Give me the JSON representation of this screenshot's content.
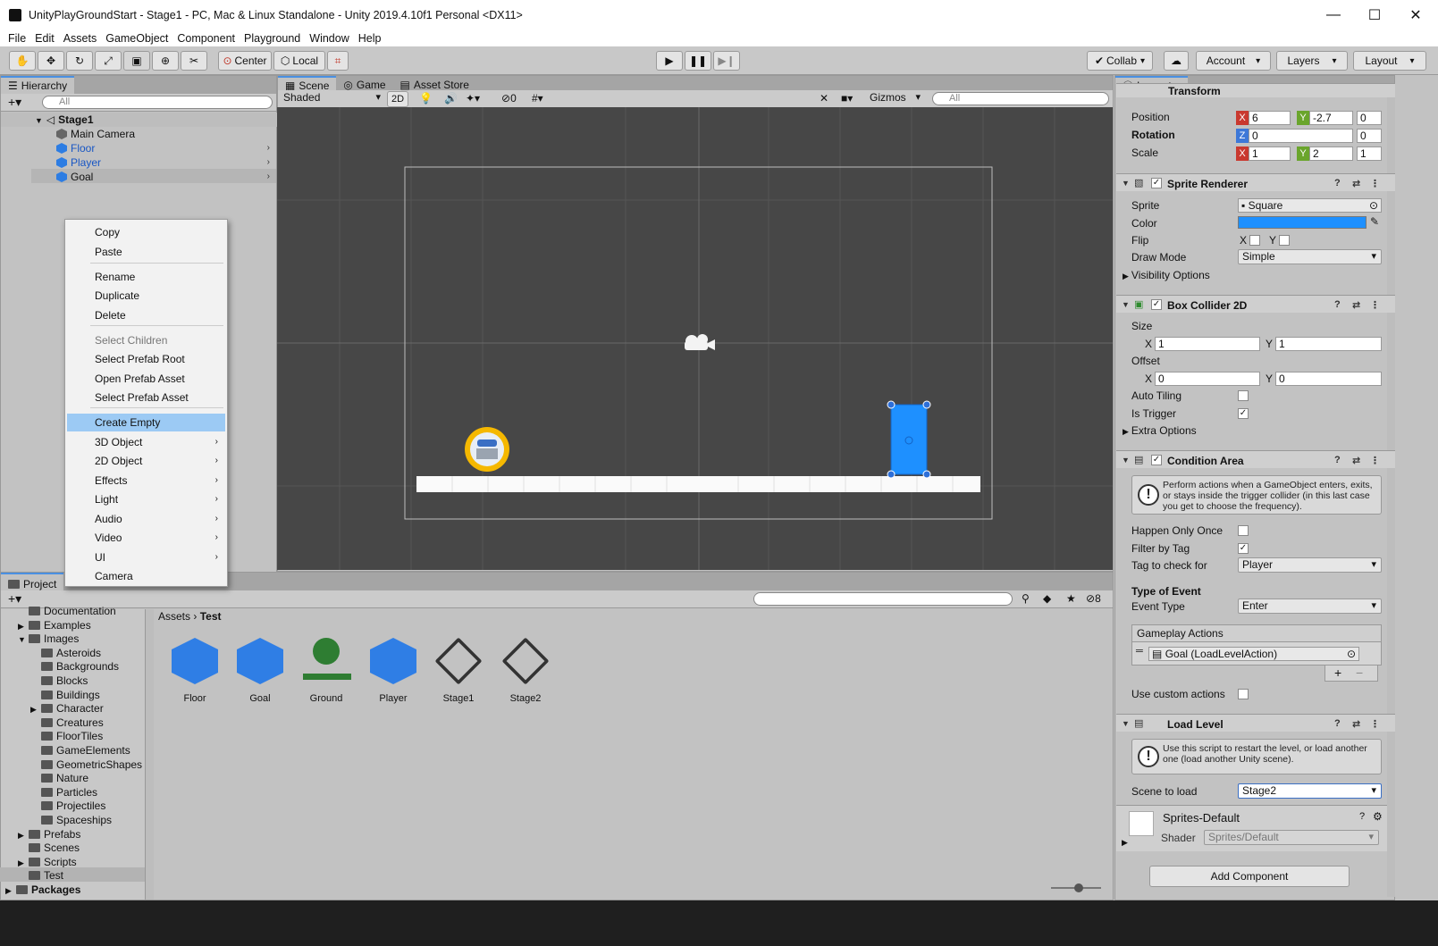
{
  "window": {
    "title": "UnityPlayGroundStart - Stage1 - PC, Mac & Linux Standalone - Unity 2019.4.10f1 Personal <DX11>",
    "minimize": "—",
    "maximize": "☐",
    "close": "✕"
  },
  "menu": [
    "File",
    "Edit",
    "Assets",
    "GameObject",
    "Component",
    "Playground",
    "Window",
    "Help"
  ],
  "toolbar": {
    "center": "Center",
    "local": "Local",
    "collab": "Collab",
    "account": "Account",
    "layers": "Layers",
    "layout": "Layout"
  },
  "hierarchy": {
    "tab": "Hierarchy",
    "search_placeholder": "All",
    "scene": "Stage1",
    "items": [
      {
        "label": "Main Camera",
        "prefab": false
      },
      {
        "label": "Floor",
        "prefab": true
      },
      {
        "label": "Player",
        "prefab": true
      },
      {
        "label": "Goal",
        "prefab": true
      }
    ]
  },
  "context_menu": {
    "items": [
      "Copy",
      "Paste",
      "Rename",
      "Duplicate",
      "Delete",
      "Select Children",
      "Select Prefab Root",
      "Open Prefab Asset",
      "Select Prefab Asset",
      "Create Empty",
      "3D Object",
      "2D Object",
      "Effects",
      "Light",
      "Audio",
      "Video",
      "UI",
      "Camera"
    ],
    "highlighted": "Create Empty",
    "disabled": [
      "Select Children"
    ]
  },
  "scene_tabs": {
    "scene": "Scene",
    "game": "Game",
    "asset_store": "Asset Store"
  },
  "scene_toolbar": {
    "shading": "Shaded",
    "mode_2d": "2D",
    "hidden_count": "0",
    "gizmos": "Gizmos",
    "search_placeholder": "All"
  },
  "inspector": {
    "tab": "Inspector",
    "transform": {
      "title": "Transform",
      "position_label": "Position",
      "position": {
        "x": "6",
        "y": "-2.7",
        "z": "0"
      },
      "rotation_label": "Rotation",
      "rotation": {
        "z": "0",
        "extra": "0"
      },
      "scale_label": "Scale",
      "scale": {
        "x": "1",
        "y": "2",
        "z": "1"
      }
    },
    "sprite_renderer": {
      "title": "Sprite Renderer",
      "sprite_label": "Sprite",
      "sprite": "Square",
      "color_label": "Color",
      "color": "#1e90ff",
      "flip_label": "Flip",
      "flip_x": "X",
      "flip_y": "Y",
      "draw_mode_label": "Draw Mode",
      "draw_mode": "Simple",
      "visibility": "Visibility Options"
    },
    "box_collider": {
      "title": "Box Collider 2D",
      "size_label": "Size",
      "size": {
        "x": "1",
        "y": "1"
      },
      "offset_label": "Offset",
      "offset": {
        "x": "0",
        "y": "0"
      },
      "auto_tiling_label": "Auto Tiling",
      "is_trigger_label": "Is Trigger",
      "extra": "Extra Options"
    },
    "condition_area": {
      "title": "Condition Area",
      "help": "Perform actions when a GameObject enters, exits, or stays inside the trigger collider (in this last case you get to choose the frequency).",
      "happen_once_label": "Happen Only Once",
      "filter_tag_label": "Filter by Tag",
      "tag_check_label": "Tag to check for",
      "tag_check": "Player",
      "type_of_event": "Type of Event",
      "event_type_label": "Event Type",
      "event_type": "Enter",
      "gameplay_actions": "Gameplay Actions",
      "action": "Goal (LoadLevelAction)",
      "plus": "+",
      "minus": "−",
      "custom_actions_label": "Use custom actions"
    },
    "load_level": {
      "title": "Load Level",
      "help": "Use this script to restart the level, or load another one (load another Unity scene).",
      "scene_label": "Scene to load",
      "scene": "Stage2"
    },
    "material": {
      "name": "Sprites-Default",
      "shader_label": "Shader",
      "shader": "Sprites/Default"
    },
    "add_component": "Add Component"
  },
  "project": {
    "tab": "Project",
    "breadcrumb": [
      "Assets",
      "Test"
    ],
    "hidden_count": "8",
    "tree": [
      {
        "label": "Documentation",
        "indent": 1,
        "arrow": ""
      },
      {
        "label": "Examples",
        "indent": 1,
        "arrow": "▶"
      },
      {
        "label": "Images",
        "indent": 1,
        "arrow": "▼"
      },
      {
        "label": "Asteroids",
        "indent": 2,
        "arrow": ""
      },
      {
        "label": "Backgrounds",
        "indent": 2,
        "arrow": ""
      },
      {
        "label": "Blocks",
        "indent": 2,
        "arrow": ""
      },
      {
        "label": "Buildings",
        "indent": 2,
        "arrow": ""
      },
      {
        "label": "Character",
        "indent": 2,
        "arrow": "▶"
      },
      {
        "label": "Creatures",
        "indent": 2,
        "arrow": ""
      },
      {
        "label": "FloorTiles",
        "indent": 2,
        "arrow": ""
      },
      {
        "label": "GameElements",
        "indent": 2,
        "arrow": ""
      },
      {
        "label": "GeometricShapes",
        "indent": 2,
        "arrow": ""
      },
      {
        "label": "Nature",
        "indent": 2,
        "arrow": ""
      },
      {
        "label": "Particles",
        "indent": 2,
        "arrow": ""
      },
      {
        "label": "Projectiles",
        "indent": 2,
        "arrow": ""
      },
      {
        "label": "Spaceships",
        "indent": 2,
        "arrow": ""
      },
      {
        "label": "Prefabs",
        "indent": 1,
        "arrow": "▶"
      },
      {
        "label": "Scenes",
        "indent": 1,
        "arrow": ""
      },
      {
        "label": "Scripts",
        "indent": 1,
        "arrow": "▶"
      },
      {
        "label": "Test",
        "indent": 1,
        "arrow": ""
      },
      {
        "label": "Packages",
        "indent": 0,
        "arrow": "▶"
      }
    ],
    "assets": [
      {
        "label": "Floor",
        "kind": "prefab"
      },
      {
        "label": "Goal",
        "kind": "prefab"
      },
      {
        "label": "Ground",
        "kind": "ground"
      },
      {
        "label": "Player",
        "kind": "prefab"
      },
      {
        "label": "Stage1",
        "kind": "scene"
      },
      {
        "label": "Stage2",
        "kind": "scene"
      }
    ]
  }
}
